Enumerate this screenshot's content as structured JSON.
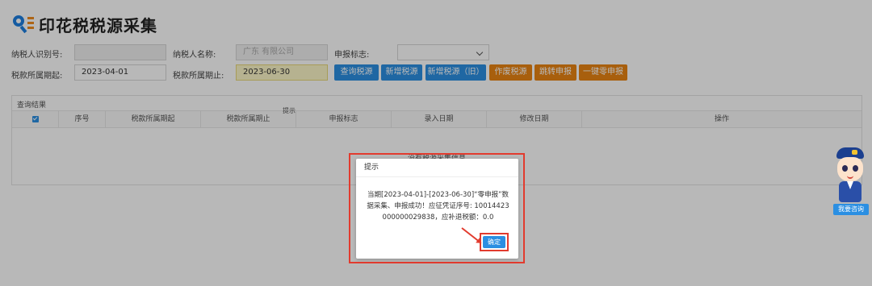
{
  "header": {
    "title": "印花税税源采集",
    "logo_icon": "search-list-icon"
  },
  "form": {
    "taxpayer_id_label": "纳税人识别号:",
    "taxpayer_id_value": "",
    "taxpayer_name_label": "纳税人名称:",
    "taxpayer_name_value": "广东              有限公司",
    "declare_flag_label": "申报标志:",
    "declare_flag_value": "",
    "period_start_label": "税款所属期起:",
    "period_start_value": "2023-04-01",
    "period_end_label": "税款所属期止:",
    "period_end_value": "2023-06-30"
  },
  "buttons": {
    "query": "查询税源",
    "add": "新增税源",
    "add_old": "新增税源（旧）",
    "void": "作废税源",
    "goto_declare": "跳转申报",
    "zero_declare": "一键零申报"
  },
  "results": {
    "title": "查询结果",
    "hint": "提示",
    "columns": [
      "序号",
      "税款所属期起",
      "税款所属期止",
      "申报标志",
      "录入日期",
      "修改日期",
      "操作"
    ],
    "empty_text": "没有税源采集信息"
  },
  "dialog": {
    "title": "提示",
    "message": "当期[2023-04-01]-[2023-06-30]“零申报”数据采集、申报成功！应征凭证序号: 10014423000000029838，应补退税额：0.0",
    "ok_label": "确定"
  },
  "assistant": {
    "label": "我要咨询"
  },
  "colors": {
    "primary": "#2b8fe2",
    "warning": "#e98413",
    "highlight": "#e23b2e"
  }
}
